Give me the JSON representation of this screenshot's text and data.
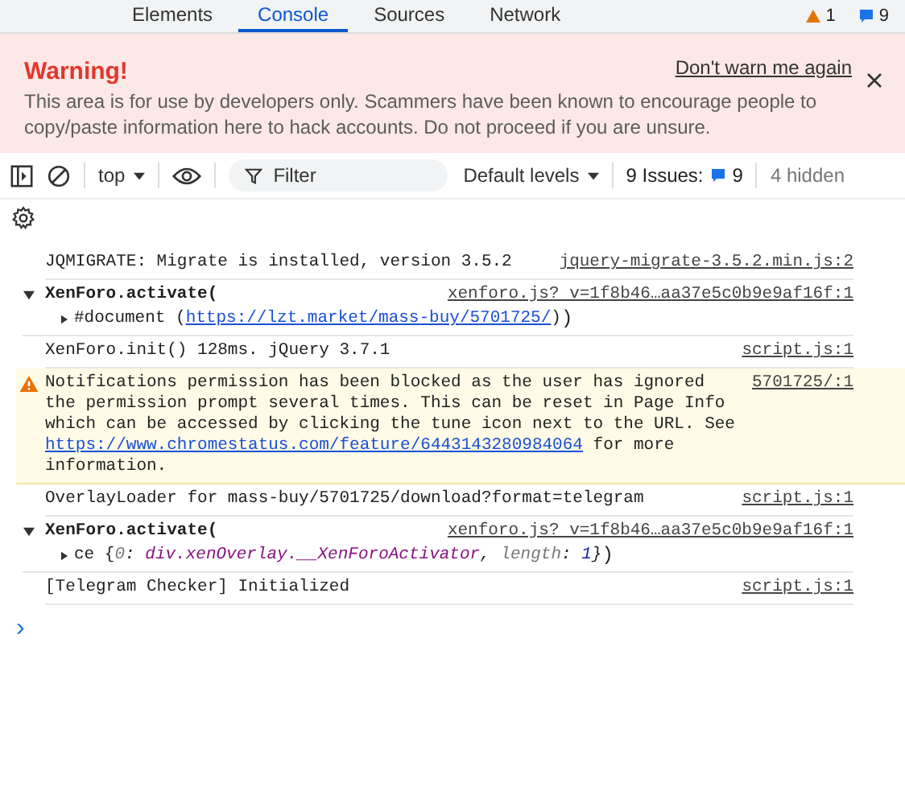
{
  "tabs": [
    {
      "label": "Elements",
      "selected": false
    },
    {
      "label": "Console",
      "selected": true
    },
    {
      "label": "Sources",
      "selected": false
    },
    {
      "label": "Network",
      "selected": false
    }
  ],
  "tab_badges": {
    "errors": "1",
    "issues": "9"
  },
  "banner": {
    "title": "Warning!",
    "text": "This area is for use by developers only. Scammers have been known to encourage people to copy/paste information here to hack accounts. Do not proceed if you are unsure.",
    "dismiss_link": "Don't warn me again"
  },
  "toolbar": {
    "context": "top",
    "filter_placeholder": "Filter",
    "levels": "Default levels",
    "issues_label": "9 Issues:",
    "issues_count": "9",
    "hidden": "4 hidden"
  },
  "messages": [
    {
      "kind": "log",
      "text": "JQMIGRATE: Migrate is installed, version 3.5.2",
      "source": "jquery-migrate-3.5.2.min.js:2"
    },
    {
      "kind": "group",
      "expanded": true,
      "text": "XenForo.activate(",
      "source": "xenforo.js? v=1f8b46…aa37e5c0b9e9af16f:1",
      "children": [
        {
          "expanded": false,
          "parts": [
            {
              "kind": "plain",
              "text": "#document ("
            },
            {
              "kind": "link",
              "text": "https://lzt.market/mass-buy/5701725/"
            },
            {
              "kind": "plain",
              "text": ")"
            }
          ],
          "tail": ")"
        }
      ]
    },
    {
      "kind": "log",
      "text": "XenForo.init() 128ms. jQuery 3.7.1",
      "source": "script.js:1"
    },
    {
      "kind": "warning",
      "text": "Notifications permission has been blocked as the user has ignored the permission prompt several times. This can be reset in Page Info which can be accessed by clicking the tune icon next to the URL. See",
      "link": "https://www.chromestatus.com/feature/6443143280984064",
      "after": "for more information.",
      "source": "5701725/:1"
    },
    {
      "kind": "log",
      "text": "OverlayLoader for mass-buy/5701725/download?format=telegram",
      "source": "script.js:1"
    },
    {
      "kind": "group",
      "expanded": true,
      "text": "XenForo.activate(",
      "source": "xenforo.js? v=1f8b46…aa37e5c0b9e9af16f:1",
      "children": [
        {
          "expanded": false,
          "parts": [
            {
              "kind": "plain",
              "text": "ce {"
            },
            {
              "kind": "key",
              "text": "0"
            },
            {
              "kind": "punct",
              "text": ": "
            },
            {
              "kind": "value",
              "text": "div.xenOverlay.__XenForoActivator"
            },
            {
              "kind": "punct",
              "text": ", "
            },
            {
              "kind": "key",
              "text": "length"
            },
            {
              "kind": "punct",
              "text": ": "
            },
            {
              "kind": "number",
              "text": "1"
            },
            {
              "kind": "punct",
              "text": "}"
            }
          ],
          "tail": ")"
        }
      ]
    },
    {
      "kind": "log",
      "text": "[Telegram Checker] Initialized",
      "source": "script.js:1"
    }
  ],
  "prompt": "›"
}
